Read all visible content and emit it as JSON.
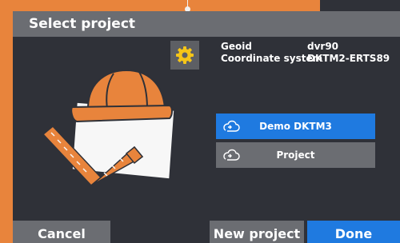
{
  "dialog": {
    "title": "Select project"
  },
  "settings": {
    "icon": "gear-icon"
  },
  "info": {
    "geoid_label": "Geoid",
    "geoid_value": "dvr90",
    "coord_label": "Coordinate system",
    "coord_value": "DKTM2-ERTS89"
  },
  "projects": [
    {
      "label": "Demo DKTM3",
      "icon": "cloud-sync-icon",
      "selected": true
    },
    {
      "label": "Project",
      "icon": "cloud-sync-icon",
      "selected": false
    }
  ],
  "footer": {
    "cancel_label": "Cancel",
    "new_label": "New project",
    "done_label": "Done"
  },
  "colors": {
    "accent": "#1f7ae0",
    "background_orange": "#e8843c",
    "panel_dark": "#2f3138",
    "button_grey": "#6b6d72",
    "icon_yellow": "#f5c518"
  }
}
